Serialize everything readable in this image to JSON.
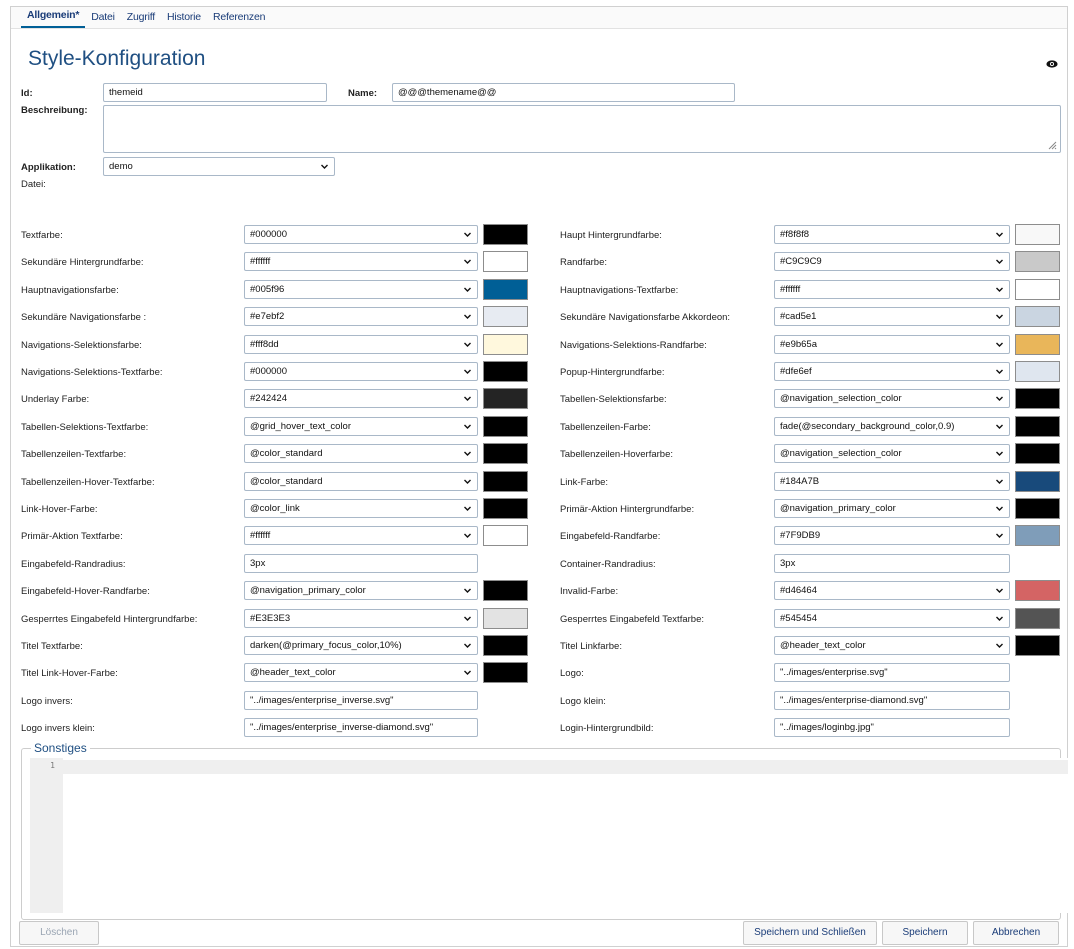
{
  "tabs": [
    {
      "label": "Allgemein*"
    },
    {
      "label": "Datei"
    },
    {
      "label": "Zugriff"
    },
    {
      "label": "Historie"
    },
    {
      "label": "Referenzen"
    }
  ],
  "page_title": "Style-Konfiguration",
  "form": {
    "id_label": "Id:",
    "id_value": "themeid",
    "name_label": "Name:",
    "name_value": "@@@themename@@",
    "desc_label": "Beschreibung:",
    "desc_value": "",
    "app_label": "Applikation:",
    "app_value": "demo",
    "file_label": "Datei:"
  },
  "left_fields": [
    {
      "label": "Textfarbe:",
      "value": "#000000",
      "swatch": "#000000"
    },
    {
      "label": "Sekundäre Hintergrundfarbe:",
      "value": "#ffffff",
      "swatch": "#ffffff"
    },
    {
      "label": "Hauptnavigationsfarbe:",
      "value": "#005f96",
      "swatch": "#005f96"
    },
    {
      "label": "Sekundäre Navigationsfarbe :",
      "value": "#e7ebf2",
      "swatch": "#e7ebf2"
    },
    {
      "label": "Navigations-Selektionsfarbe:",
      "value": "#fff8dd",
      "swatch": "#fff8dd"
    },
    {
      "label": "Navigations-Selektions-Textfarbe:",
      "value": "#000000",
      "swatch": "#000000"
    },
    {
      "label": "Underlay Farbe:",
      "value": "#242424",
      "swatch": "#242424"
    },
    {
      "label": "Tabellen-Selektions-Textfarbe:",
      "value": "@grid_hover_text_color",
      "swatch": "#000000"
    },
    {
      "label": "Tabellenzeilen-Textfarbe:",
      "value": "@color_standard",
      "swatch": "#000000"
    },
    {
      "label": "Tabellenzeilen-Hover-Textfarbe:",
      "value": "@color_standard",
      "swatch": "#000000"
    },
    {
      "label": "Link-Hover-Farbe:",
      "value": "@color_link",
      "swatch": "#000000"
    },
    {
      "label": "Primär-Aktion Textfarbe:",
      "value": "#ffffff",
      "swatch": "#ffffff"
    },
    {
      "label": "Eingabefeld-Randradius:",
      "value": "3px",
      "text": true
    },
    {
      "label": "Eingabefeld-Hover-Randfarbe:",
      "value": "@navigation_primary_color",
      "swatch": "#000000"
    },
    {
      "label": "Gesperrtes Eingabefeld Hintergrundfarbe:",
      "value": "#E3E3E3",
      "swatch": "#e3e3e3"
    },
    {
      "label": "Titel Textfarbe:",
      "value": "darken(@primary_focus_color,10%)",
      "swatch": "#000000"
    },
    {
      "label": "Titel Link-Hover-Farbe:",
      "value": "@header_text_color",
      "swatch": "#000000"
    },
    {
      "label": "Logo invers:",
      "value": "\"../images/enterprise_inverse.svg\"",
      "text": true
    },
    {
      "label": "Logo invers klein:",
      "value": "\"../images/enterprise_inverse-diamond.svg\"",
      "text": true
    }
  ],
  "right_fields": [
    {
      "label": "Haupt Hintergrundfarbe:",
      "value": "#f8f8f8",
      "swatch": "#f8f8f8"
    },
    {
      "label": "Randfarbe:",
      "value": "#C9C9C9",
      "swatch": "#c9c9c9"
    },
    {
      "label": "Hauptnavigations-Textfarbe:",
      "value": "#ffffff",
      "swatch": "#ffffff"
    },
    {
      "label": "Sekundäre Navigationsfarbe Akkordeon:",
      "value": "#cad5e1",
      "swatch": "#cad5e1"
    },
    {
      "label": "Navigations-Selektions-Randfarbe:",
      "value": "#e9b65a",
      "swatch": "#e9b65a"
    },
    {
      "label": "Popup-Hintergrundfarbe:",
      "value": "#dfe6ef",
      "swatch": "#dfe6ef"
    },
    {
      "label": "Tabellen-Selektionsfarbe:",
      "value": "@navigation_selection_color",
      "swatch": "#000000"
    },
    {
      "label": "Tabellenzeilen-Farbe:",
      "value": "fade(@secondary_background_color,0.9)",
      "swatch": "#000000"
    },
    {
      "label": "Tabellenzeilen-Hoverfarbe:",
      "value": "@navigation_selection_color",
      "swatch": "#000000"
    },
    {
      "label": "Link-Farbe:",
      "value": "#184A7B",
      "swatch": "#184a7b"
    },
    {
      "label": "Primär-Aktion Hintergrundfarbe:",
      "value": "@navigation_primary_color",
      "swatch": "#000000"
    },
    {
      "label": "Eingabefeld-Randfarbe:",
      "value": "#7F9DB9",
      "swatch": "#7f9db9"
    },
    {
      "label": "Container-Randradius:",
      "value": "3px",
      "text": true
    },
    {
      "label": "Invalid-Farbe:",
      "value": "#d46464",
      "swatch": "#d46464"
    },
    {
      "label": "Gesperrtes Eingabefeld Textfarbe:",
      "value": "#545454",
      "swatch": "#545454"
    },
    {
      "label": "Titel Linkfarbe:",
      "value": "@header_text_color",
      "swatch": "#000000"
    },
    {
      "label": "Logo:",
      "value": "\"../images/enterprise.svg\"",
      "text": true
    },
    {
      "label": "Logo klein:",
      "value": "\"../images/enterprise-diamond.svg\"",
      "text": true
    },
    {
      "label": "Login-Hintergrundbild:",
      "value": "\"../images/loginbg.jpg\"",
      "text": true
    }
  ],
  "sonstiges": {
    "legend": "Sonstiges",
    "line_number": "1",
    "content": ""
  },
  "buttons": {
    "delete": "Löschen",
    "save_close": "Speichern und Schließen",
    "save": "Speichern",
    "cancel": "Abbrechen"
  },
  "icons": {
    "preview": "eye-icon",
    "dropdown": "chevron-down-icon",
    "resize": "resize-handle-icon"
  }
}
